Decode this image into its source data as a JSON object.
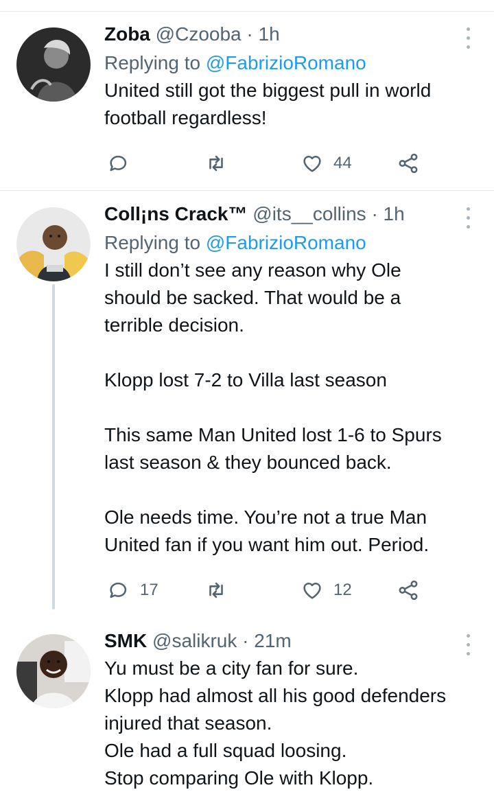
{
  "tweets": [
    {
      "name": "Zoba",
      "handle": "@Czooba",
      "time": "· 1h",
      "replying_prefix": "Replying to",
      "replying_to": "@FabrizioRomano",
      "text_lines": [
        "United still got the biggest pull in world",
        "football regardless!"
      ],
      "replies": "",
      "retweets": "",
      "likes": "44"
    },
    {
      "name": "Coll¡ns Crack™",
      "handle": "@its__collins",
      "time": "· 1h",
      "replying_prefix": "Replying to",
      "replying_to": "@FabrizioRomano",
      "text_lines": [
        "I still don’t see any reason why Ole",
        "should be sacked. That would be a",
        "terrible decision.",
        "",
        "Klopp lost 7-2 to Villa last season",
        "",
        "This same Man United lost 1-6 to Spurs",
        "last season & they bounced back.",
        "",
        "Ole needs time. You’re not a true Man",
        "United fan if you want him out. Period."
      ],
      "replies": "17",
      "retweets": "",
      "likes": "12"
    },
    {
      "name": "SMK",
      "handle": "@salikruk",
      "time": "· 21m",
      "text_lines": [
        "Yu must be a city fan for sure.",
        "Klopp had almost all his good defenders",
        "injured that season.",
        "Ole had a full squad loosing.",
        "Stop comparing Ole with Klopp."
      ]
    }
  ],
  "icons": {
    "reply": "comment-icon",
    "retweet": "retweet-icon",
    "like": "heart-icon",
    "share": "share-icon",
    "more": "more-vertical-icon"
  },
  "colors": {
    "text": "#0f1419",
    "muted": "#536471",
    "link": "#1d9bf0",
    "thread_line": "#cfd9de",
    "divider": "#e6e9eb"
  }
}
